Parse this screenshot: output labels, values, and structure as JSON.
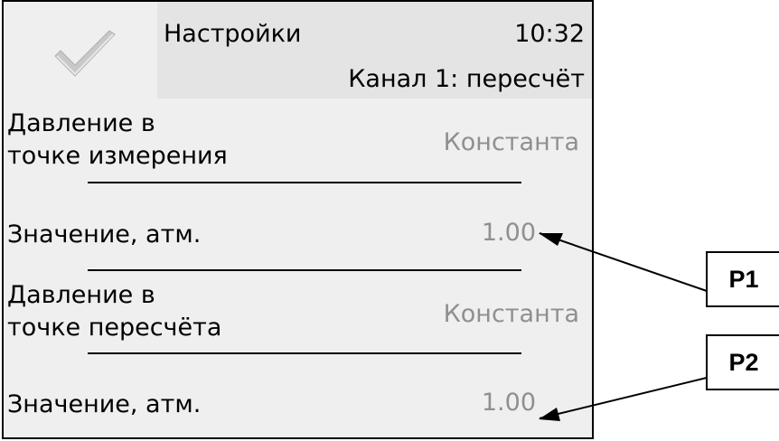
{
  "header": {
    "title": "Настройки",
    "time": "10:32",
    "subtitle": "Канал 1: пересчёт"
  },
  "rows": [
    {
      "label_line1": "Давление в",
      "label_line2": "точке измерения",
      "value": "Константа"
    },
    {
      "label": "Значение, атм.",
      "value": "1.00"
    },
    {
      "label_line1": "Давление в",
      "label_line2": "точке пересчёта",
      "value": "Константа"
    },
    {
      "label": "Значение, атм.",
      "value": "1.00"
    }
  ],
  "callouts": [
    {
      "tag": "P1"
    },
    {
      "tag": "P2"
    }
  ],
  "icons": {
    "confirm": "checkmark-icon"
  },
  "colors": {
    "header_bg": "#e4e4e4",
    "screen_bg": "#efefef",
    "value_text": "#8f8f8f",
    "checkmark": "#c8c8c8"
  }
}
